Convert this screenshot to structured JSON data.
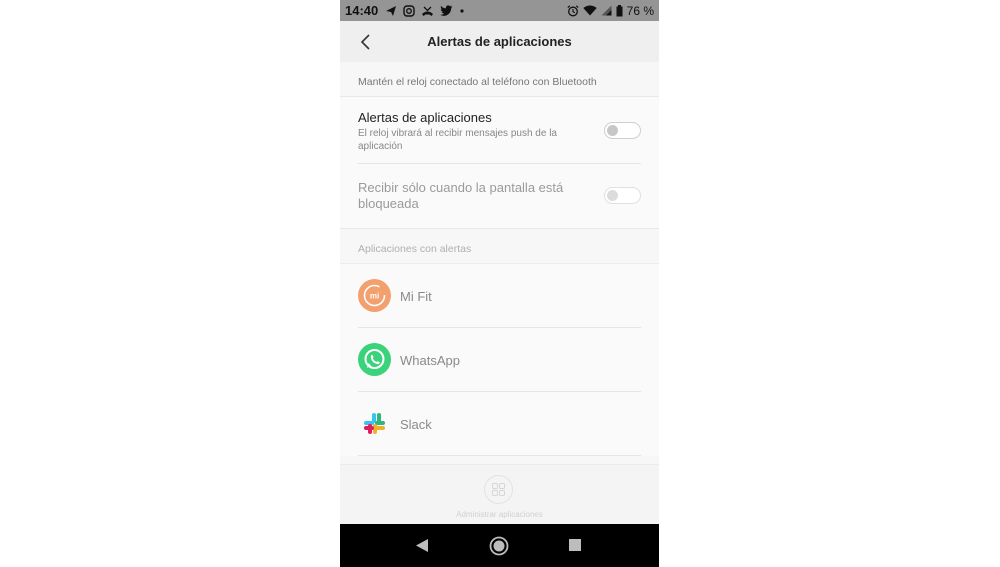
{
  "status_bar": {
    "time": "14:40",
    "left_icons": [
      "send-icon",
      "instagram-icon",
      "missed-call-icon",
      "twitter-icon",
      "dot-icon"
    ],
    "right_icons": [
      "alarm-icon",
      "wifi-icon",
      "signal-icon",
      "battery-icon"
    ],
    "battery_text": "76 %"
  },
  "header": {
    "title": "Alertas de aplicaciones"
  },
  "note": "Mantén el reloj conectado al teléfono con Bluetooth",
  "settings": {
    "app_alerts": {
      "title": "Alertas de aplicaciones",
      "description": "El reloj vibrará al recibir mensajes push de la aplicación",
      "enabled": false
    },
    "locked_only": {
      "title": "Recibir sólo cuando la pantalla está bloqueada",
      "enabled": false
    }
  },
  "section_title": "Aplicaciones con alertas",
  "apps": [
    {
      "name": "Mi Fit",
      "icon": "mi-fit-icon",
      "color": "#f0a070"
    },
    {
      "name": "WhatsApp",
      "icon": "whatsapp-icon",
      "color": "#25d366"
    },
    {
      "name": "Slack",
      "icon": "slack-icon",
      "color": "#e01e5a"
    }
  ],
  "manage": {
    "label": "Administrar aplicaciones",
    "icon": "grid-icon"
  },
  "nav": {
    "buttons": [
      "back-triangle-icon",
      "home-circle-icon",
      "recent-square-icon"
    ]
  }
}
